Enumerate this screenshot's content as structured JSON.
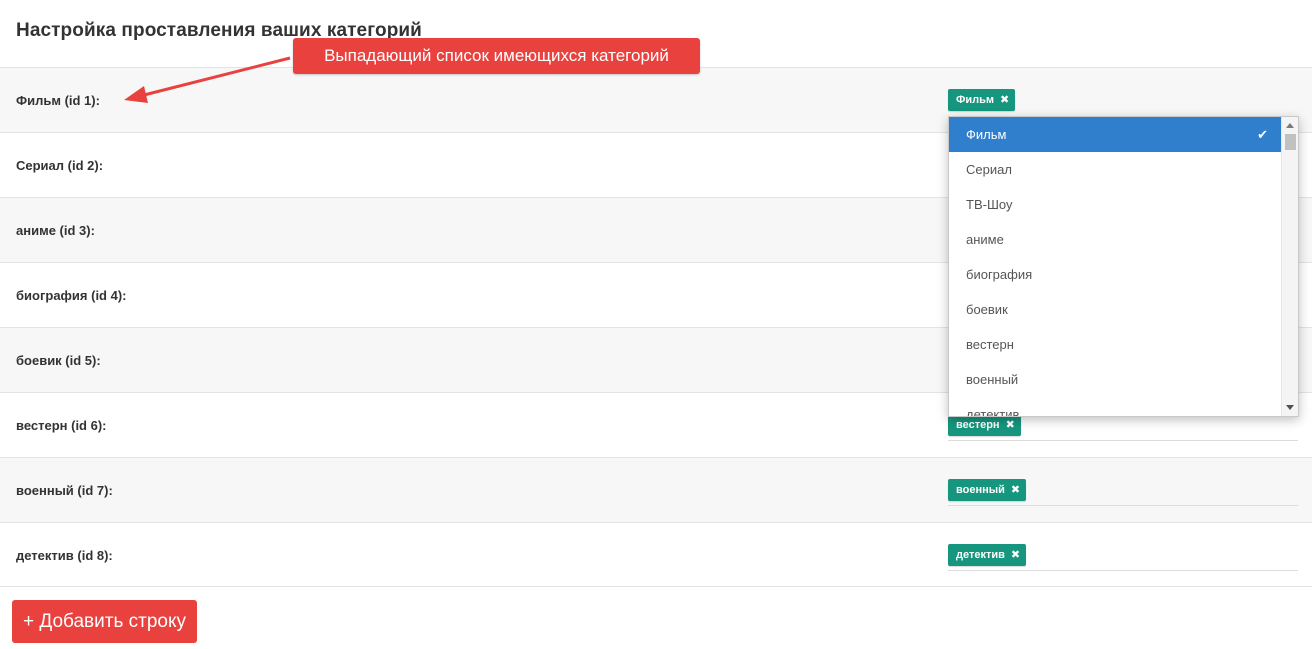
{
  "page": {
    "title": "Настройка проставления ваших категорий"
  },
  "annotation": {
    "text": "Выпадающий список имеющихся категорий"
  },
  "rows": [
    {
      "label": "Фильм (id 1):",
      "tag": "Фильм"
    },
    {
      "label": "Сериал (id 2):",
      "tag": ""
    },
    {
      "label": "аниме (id 3):",
      "tag": ""
    },
    {
      "label": "биография (id 4):",
      "tag": ""
    },
    {
      "label": "боевик (id 5):",
      "tag": ""
    },
    {
      "label": "вестерн (id 6):",
      "tag": "вестерн"
    },
    {
      "label": "военный (id 7):",
      "tag": "военный"
    },
    {
      "label": "детектив (id 8):",
      "tag": "детектив"
    }
  ],
  "tag_remove_icon": "✖",
  "dropdown": {
    "selected": "Фильм",
    "options": [
      "Фильм",
      "Сериал",
      "ТВ-Шоу",
      "аниме",
      "биография",
      "боевик",
      "вестерн",
      "военный",
      "детектив"
    ]
  },
  "add_button_label": "+ Добавить строку",
  "colors": {
    "tag": "#16967e",
    "accent_red": "#e8413e",
    "selected_option": "#2f7fcc"
  }
}
